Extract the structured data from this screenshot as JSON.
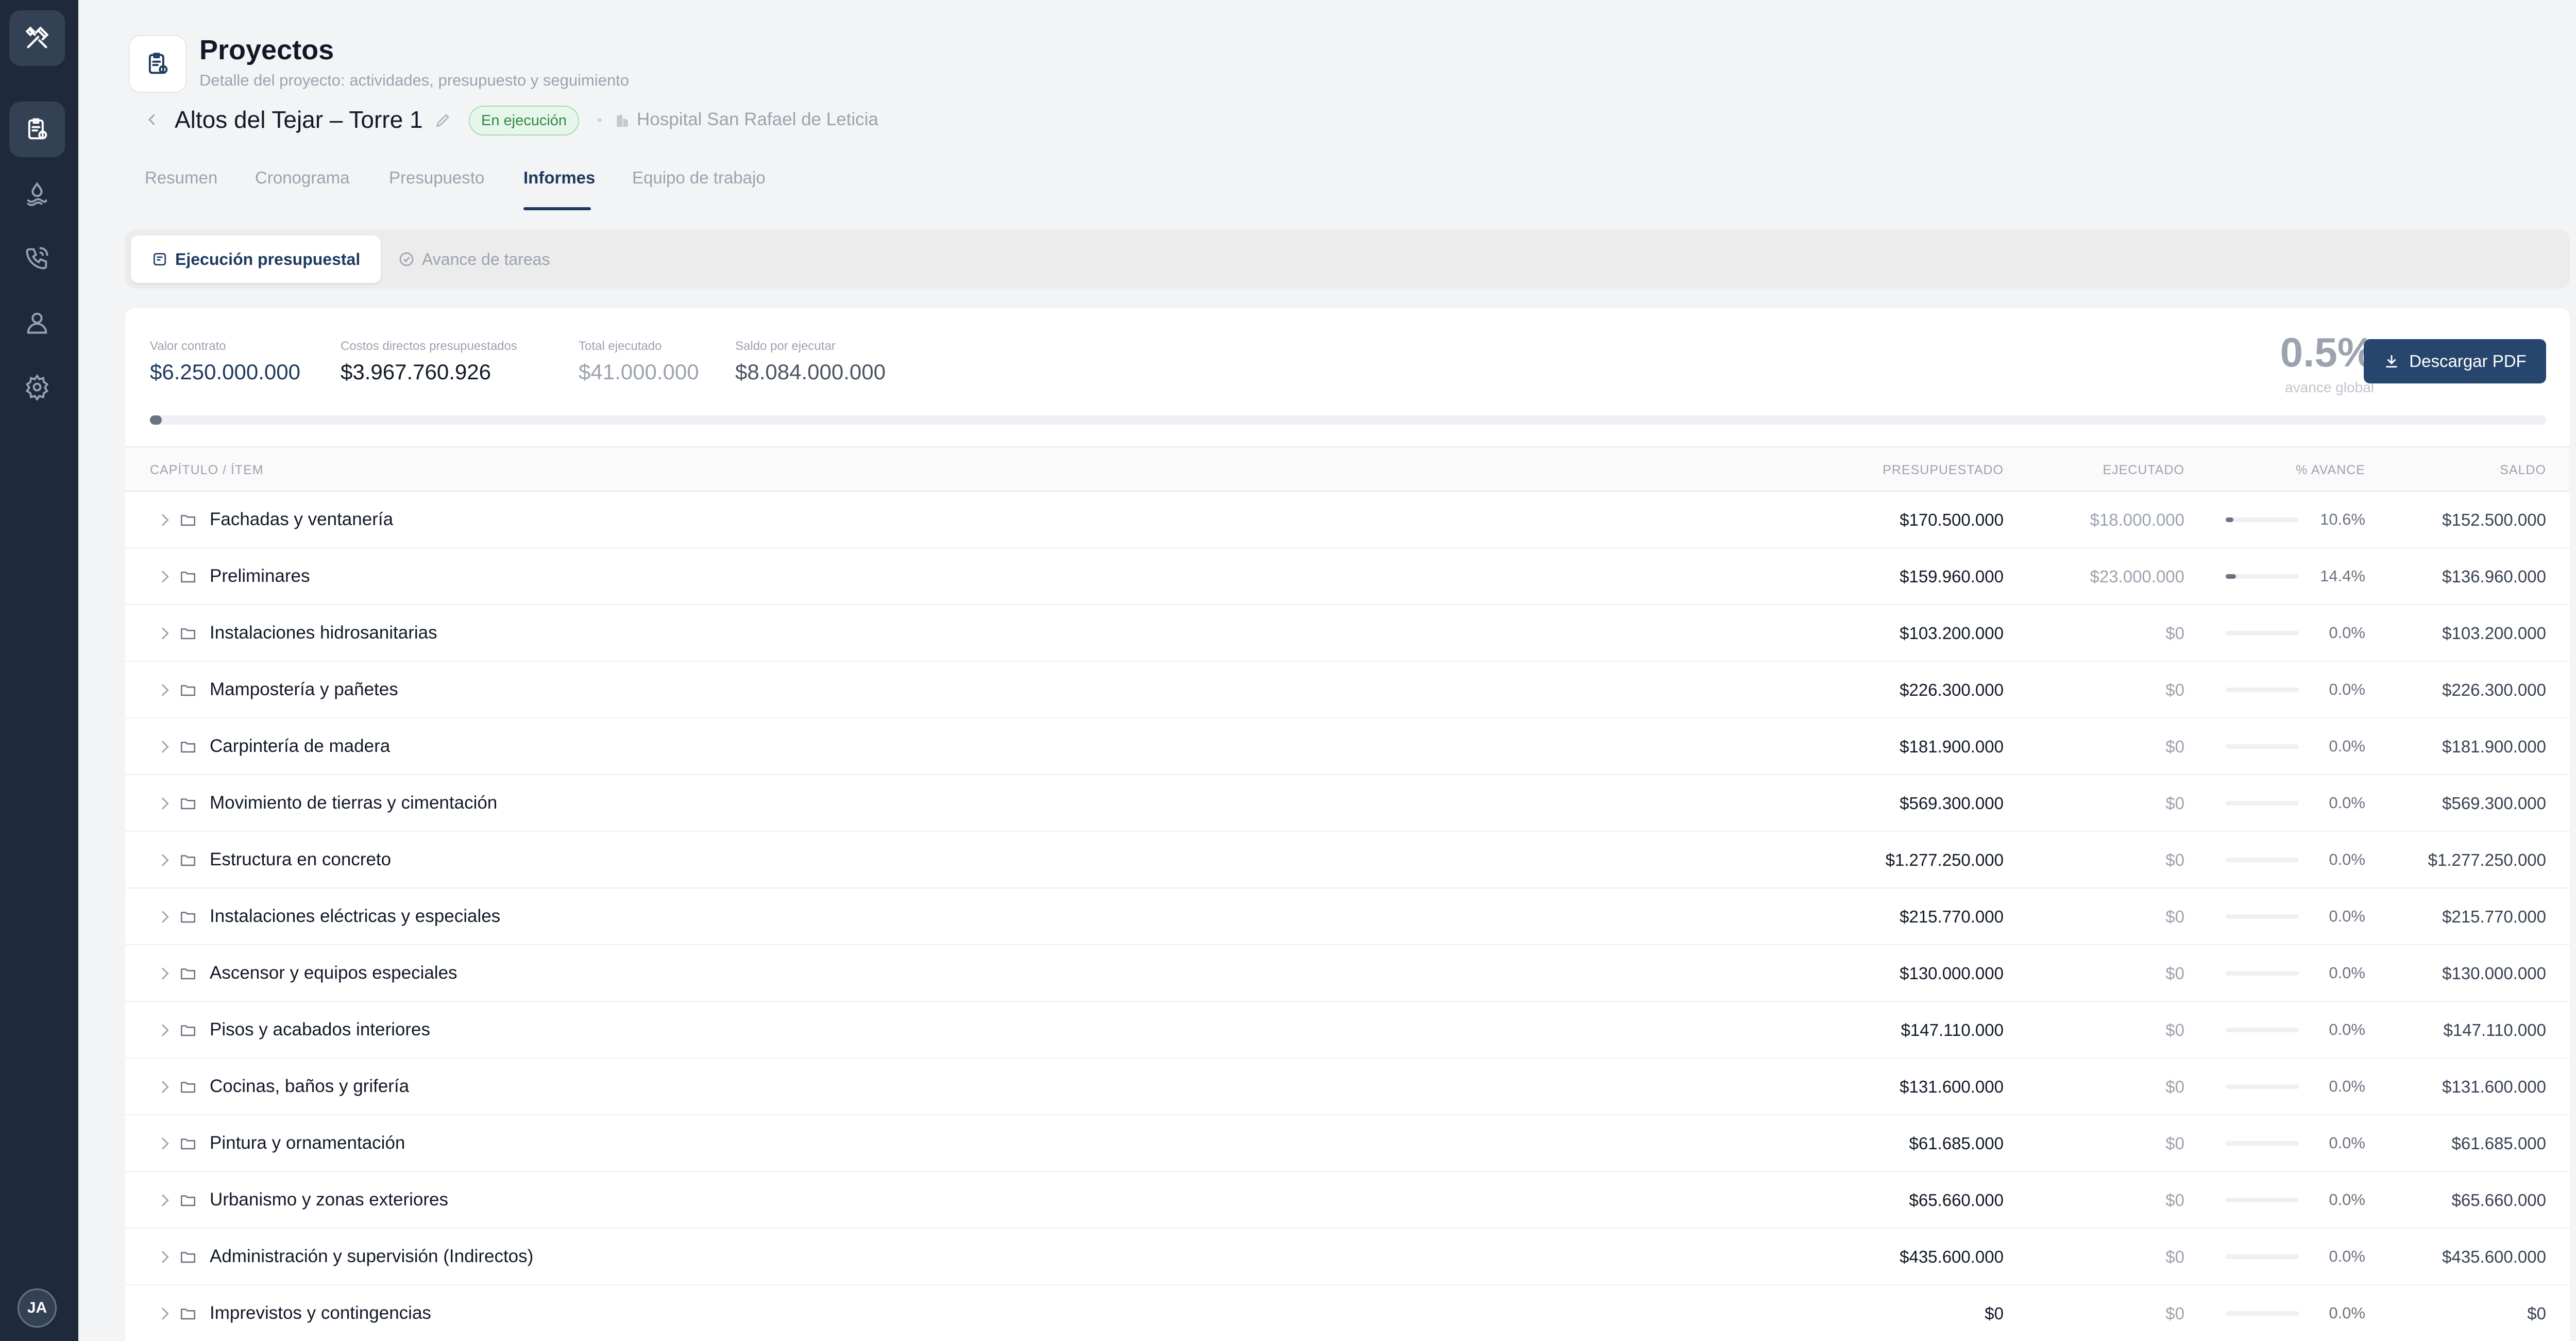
{
  "sidebar": {
    "items": [
      {
        "name": "tools-icon"
      },
      {
        "name": "projects-icon"
      },
      {
        "name": "water-drop-icon"
      },
      {
        "name": "phone-icon"
      },
      {
        "name": "user-icon"
      },
      {
        "name": "settings-icon"
      }
    ],
    "avatar_initials": "JA"
  },
  "header": {
    "title": "Proyectos",
    "subtitle": "Detalle del proyecto: actividades, presupuesto y seguimiento"
  },
  "project": {
    "name": "Altos del Tejar – Torre 1",
    "status": "En ejecución",
    "client": "Hospital San Rafael de Leticia"
  },
  "tabs": [
    {
      "label": "Resumen"
    },
    {
      "label": "Cronograma"
    },
    {
      "label": "Presupuesto"
    },
    {
      "label": "Informes"
    },
    {
      "label": "Equipo de trabajo"
    }
  ],
  "subtabs": [
    {
      "label": "Ejecución presupuestal"
    },
    {
      "label": "Avance de tareas"
    }
  ],
  "metrics": [
    {
      "label": "Valor contrato",
      "value": "$6.250.000.000"
    },
    {
      "label": "Costos directos presupuestados",
      "value": "$3.967.760.926"
    },
    {
      "label": "Total ejecutado",
      "value": "$41.000.000"
    },
    {
      "label": "Saldo por ejecutar",
      "value": "$8.084.000.000"
    }
  ],
  "global": {
    "percent": "0.5%",
    "label": "avance global",
    "progress_fraction": 0.005
  },
  "download_button": "Descargar PDF",
  "table": {
    "headers": {
      "item": "CAPÍTULO / ÍTEM",
      "presupuestado": "PRESUPUESTADO",
      "ejecutado": "EJECUTADO",
      "avance": "% AVANCE",
      "saldo": "SALDO"
    },
    "rows": [
      {
        "name": "Fachadas y ventanería",
        "presupuestado": "$170.500.000",
        "ejecutado": "$18.000.000",
        "avance": "10.6%",
        "progress": 0.106,
        "saldo": "$152.500.000"
      },
      {
        "name": "Preliminares",
        "presupuestado": "$159.960.000",
        "ejecutado": "$23.000.000",
        "avance": "14.4%",
        "progress": 0.144,
        "saldo": "$136.960.000"
      },
      {
        "name": "Instalaciones hidrosanitarias",
        "presupuestado": "$103.200.000",
        "ejecutado": "$0",
        "avance": "0.0%",
        "progress": 0,
        "saldo": "$103.200.000"
      },
      {
        "name": "Mampostería y pañetes",
        "presupuestado": "$226.300.000",
        "ejecutado": "$0",
        "avance": "0.0%",
        "progress": 0,
        "saldo": "$226.300.000"
      },
      {
        "name": "Carpintería de madera",
        "presupuestado": "$181.900.000",
        "ejecutado": "$0",
        "avance": "0.0%",
        "progress": 0,
        "saldo": "$181.900.000"
      },
      {
        "name": "Movimiento de tierras y cimentación",
        "presupuestado": "$569.300.000",
        "ejecutado": "$0",
        "avance": "0.0%",
        "progress": 0,
        "saldo": "$569.300.000"
      },
      {
        "name": "Estructura en concreto",
        "presupuestado": "$1.277.250.000",
        "ejecutado": "$0",
        "avance": "0.0%",
        "progress": 0,
        "saldo": "$1.277.250.000"
      },
      {
        "name": "Instalaciones eléctricas y especiales",
        "presupuestado": "$215.770.000",
        "ejecutado": "$0",
        "avance": "0.0%",
        "progress": 0,
        "saldo": "$215.770.000"
      },
      {
        "name": "Ascensor y equipos especiales",
        "presupuestado": "$130.000.000",
        "ejecutado": "$0",
        "avance": "0.0%",
        "progress": 0,
        "saldo": "$130.000.000"
      },
      {
        "name": "Pisos y acabados interiores",
        "presupuestado": "$147.110.000",
        "ejecutado": "$0",
        "avance": "0.0%",
        "progress": 0,
        "saldo": "$147.110.000"
      },
      {
        "name": "Cocinas, baños y grifería",
        "presupuestado": "$131.600.000",
        "ejecutado": "$0",
        "avance": "0.0%",
        "progress": 0,
        "saldo": "$131.600.000"
      },
      {
        "name": "Pintura y ornamentación",
        "presupuestado": "$61.685.000",
        "ejecutado": "$0",
        "avance": "0.0%",
        "progress": 0,
        "saldo": "$61.685.000"
      },
      {
        "name": "Urbanismo y zonas exteriores",
        "presupuestado": "$65.660.000",
        "ejecutado": "$0",
        "avance": "0.0%",
        "progress": 0,
        "saldo": "$65.660.000"
      },
      {
        "name": "Administración y supervisión (Indirectos)",
        "presupuestado": "$435.600.000",
        "ejecutado": "$0",
        "avance": "0.0%",
        "progress": 0,
        "saldo": "$435.600.000"
      },
      {
        "name": "Imprevistos y contingencias",
        "presupuestado": "$0",
        "ejecutado": "$0",
        "avance": "0.0%",
        "progress": 0,
        "saldo": "$0"
      }
    ]
  },
  "colors": {
    "sidebar_bg": "#1e293b",
    "accent": "#26466d",
    "status_green": "#2f8a45"
  }
}
